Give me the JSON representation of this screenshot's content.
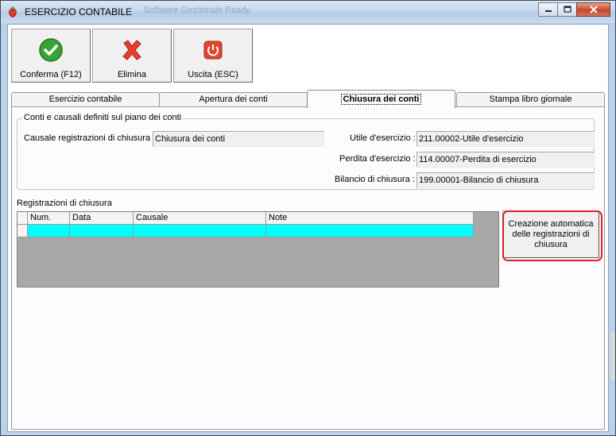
{
  "window": {
    "title": "ESERCIZIO CONTABILE",
    "ghost_title": "Software Gestionale Ready"
  },
  "toolbar": {
    "confirm_label": "Conferma (F12)",
    "delete_label": "Elimina",
    "exit_label": "Uscita (ESC)"
  },
  "tabs": [
    {
      "label": "Esercizio contabile"
    },
    {
      "label": "Apertura dei conti"
    },
    {
      "label": "Chiusura dei conti",
      "active": true
    },
    {
      "label": "Stampa libro giornale"
    }
  ],
  "group": {
    "title": "Conti e causali definiti sul piano dei conti",
    "causale_label": "Causale registrazioni di chiusura :",
    "causale_value": "Chiusura dei conti",
    "utile_label": "Utile d'esercizio :",
    "utile_value": "211.00002-Utile d'esercizio",
    "perdita_label": "Perdita d'esercizio :",
    "perdita_value": "114.00007-Perdita di esercizio",
    "bilancio_label": "Bilancio di chiusura :",
    "bilancio_value": "199.00001-Bilancio di chiusura"
  },
  "registrazioni": {
    "label": "Registrazioni di chiusura",
    "columns": [
      "Num.",
      "Data",
      "Causale",
      "Note"
    ]
  },
  "auto_button": {
    "label": "Creazione automatica delle registrazioni di chiusura"
  },
  "colors": {
    "row_selected": "#00ffff",
    "highlight": "#e0202a",
    "grid_bg": "#a8a8a8"
  }
}
